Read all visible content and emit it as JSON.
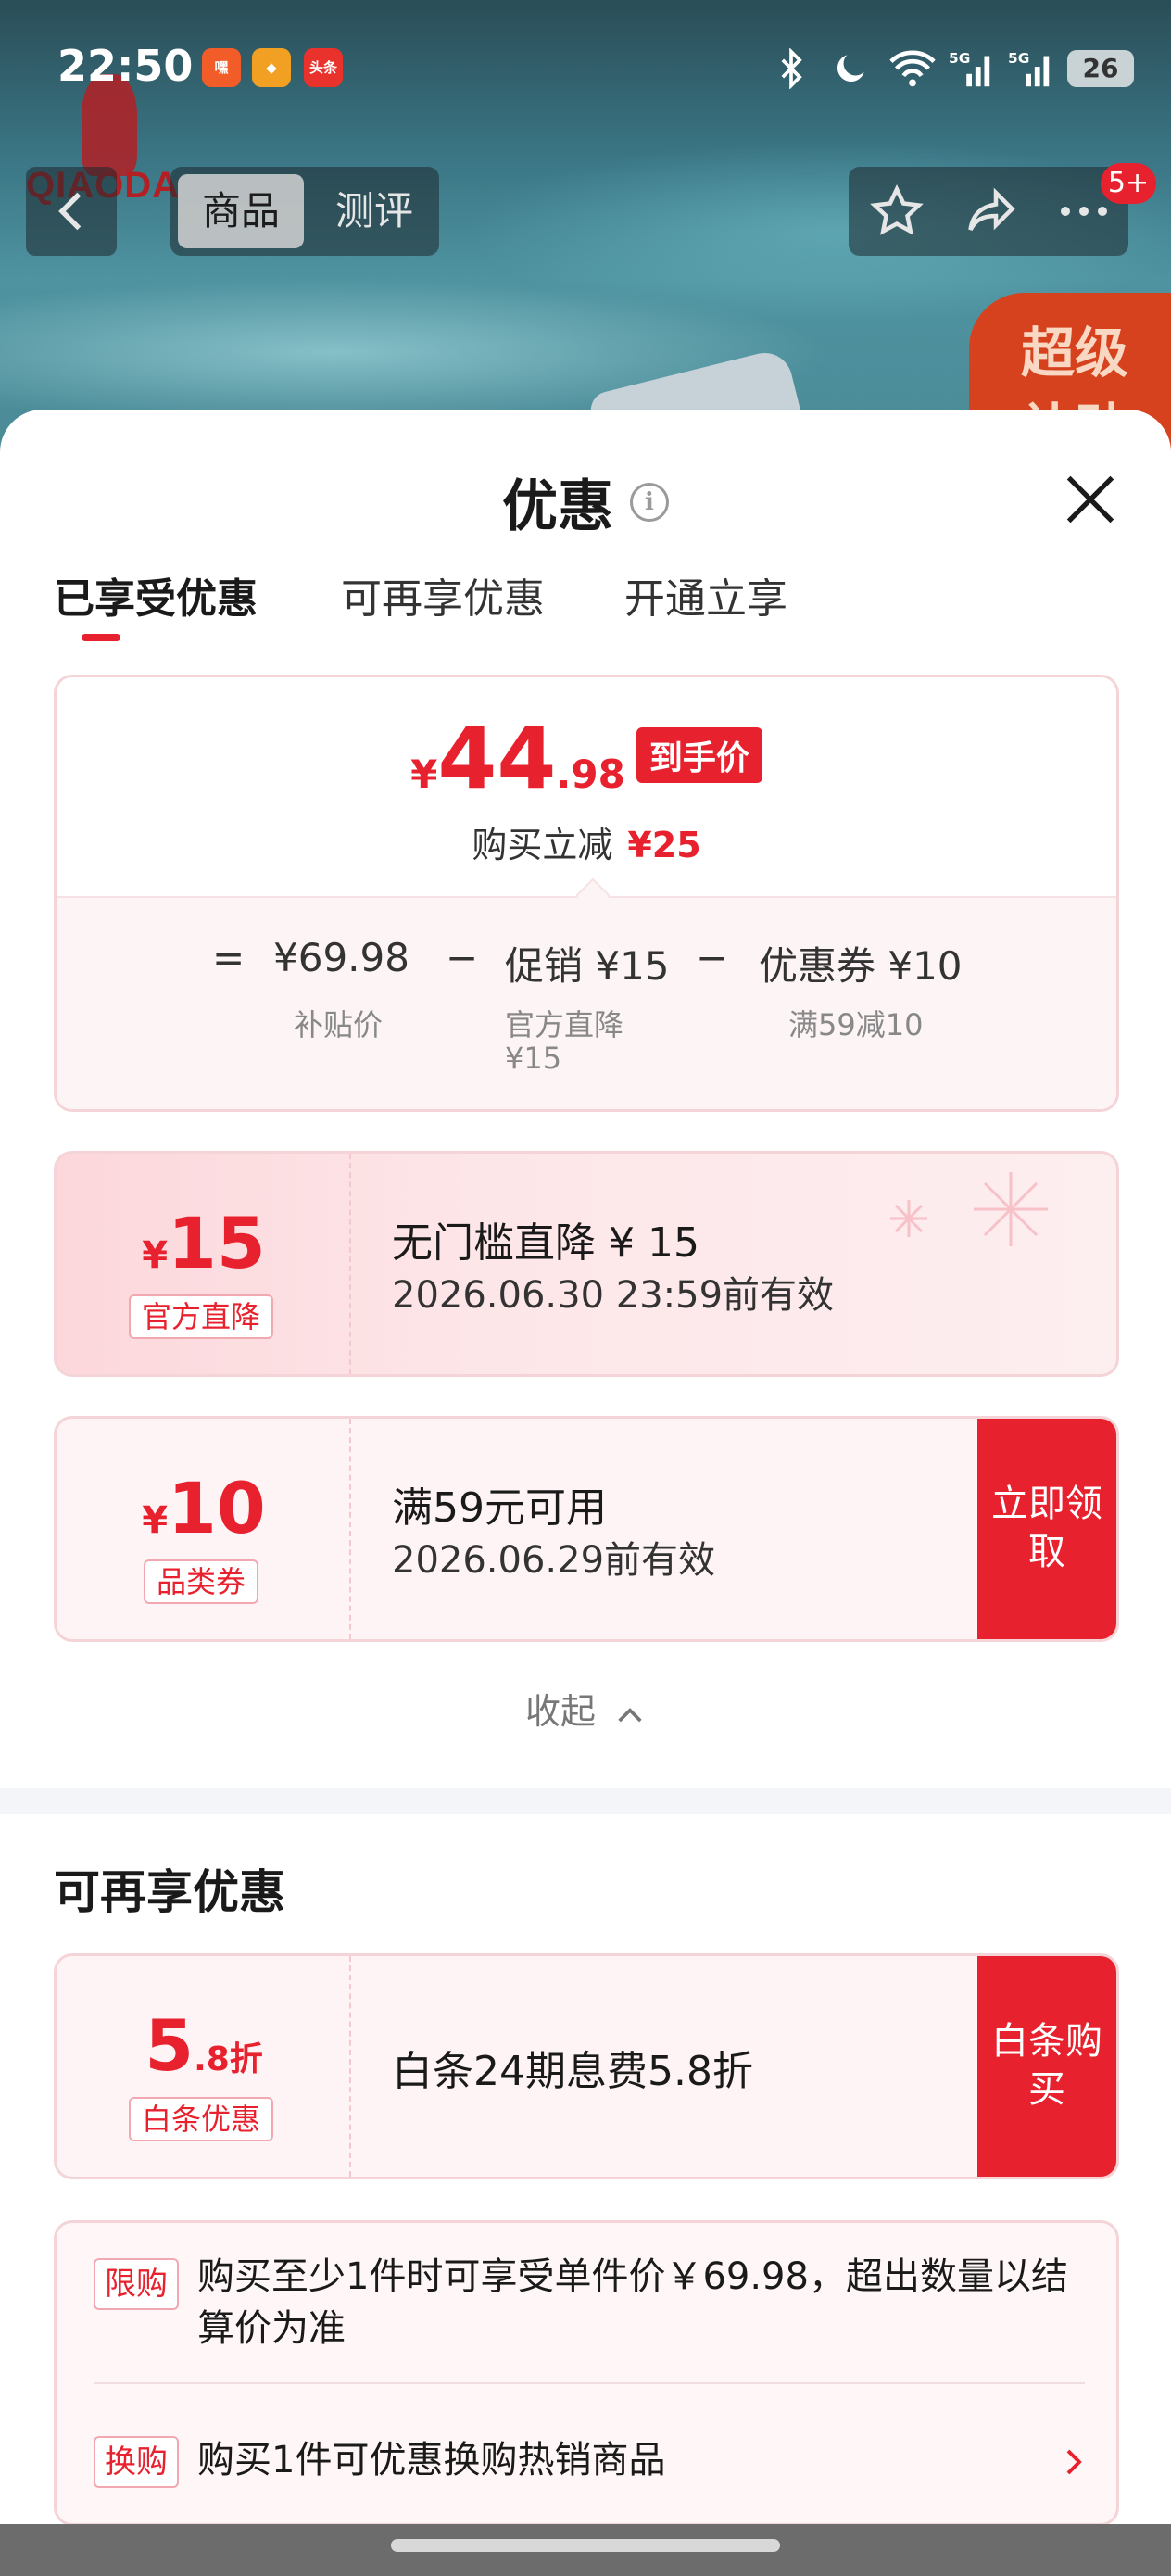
{
  "status_bar": {
    "time": "22:50",
    "apps": [
      {
        "name": "app-icon-1",
        "label": "嘿",
        "color": "#f25c28"
      },
      {
        "name": "app-icon-2",
        "label": "◆",
        "color": "#f2a024"
      },
      {
        "name": "app-icon-3",
        "label": "头条",
        "color": "#e8322b"
      }
    ],
    "battery": "26",
    "signal_labels": [
      "5G",
      "5G"
    ]
  },
  "backdrop": {
    "brand": "QIAODA",
    "badge": "超级补贴"
  },
  "nav": {
    "tab_goods": "商品",
    "tab_reviews": "测评",
    "message_badge": "5+"
  },
  "sheet": {
    "title": "优惠",
    "info": "i",
    "tabs": [
      "已享受优惠",
      "可再享优惠",
      "开通立享"
    ]
  },
  "price": {
    "currency": "¥",
    "integer": "44",
    "decimal": ".98",
    "tag": "到手价",
    "sub_label": "购买立减",
    "sub_value": "¥25",
    "formula": {
      "eq": "=",
      "base": "¥69.98",
      "minus1": "−",
      "promo": "促销 ¥15",
      "minus2": "−",
      "coupon": "优惠券 ¥10"
    },
    "labels": {
      "base": "补贴价",
      "promo_line1": "官方直降",
      "promo_line2": "¥15",
      "coupon": "满59减10"
    }
  },
  "coupons": [
    {
      "currency": "¥",
      "amount": "15",
      "tag": "官方直降",
      "title": "无门槛直降 ¥ 15",
      "validity": "2026.06.30 23:59前有效"
    },
    {
      "currency": "¥",
      "amount": "10",
      "tag": "品类券",
      "title": "满59元可用",
      "validity": "2026.06.29前有效",
      "action": "立即领取"
    }
  ],
  "collapse_label": "收起",
  "more_section": {
    "title": "可再享优惠",
    "baitiao": {
      "amount": "5",
      "suffix": ".8折",
      "tag": "白条优惠",
      "title": "白条24期息费5.8折",
      "action": "白条购买"
    }
  },
  "rules": [
    {
      "tag": "限购",
      "text": "购买至少1件时可享受单件价￥69.98，超出数量以结算价为准"
    },
    {
      "tag": "换购",
      "text": "购买1件可优惠换购热销商品"
    }
  ],
  "colors": {
    "accent": "#e8212e",
    "card_border": "#f5d4d8",
    "card_bg": "#fef4f5"
  }
}
